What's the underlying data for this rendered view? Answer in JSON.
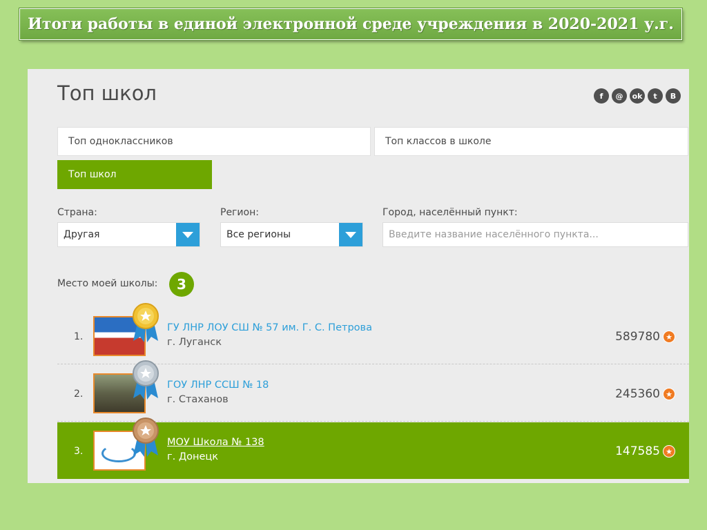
{
  "banner": {
    "title": "Итоги работы в единой электронной среде учреждения в 2020-2021 у.г."
  },
  "page": {
    "title": "Топ школ"
  },
  "social": [
    {
      "icon": "facebook-icon",
      "glyph": "f"
    },
    {
      "icon": "mail-icon",
      "glyph": "@"
    },
    {
      "icon": "odnoklassniki-icon",
      "glyph": "ok"
    },
    {
      "icon": "twitter-icon",
      "glyph": "t"
    },
    {
      "icon": "vk-icon",
      "glyph": "B"
    }
  ],
  "tabs": {
    "classmates": "Топ одноклассников",
    "classes": "Топ классов в школе",
    "schools": "Топ школ"
  },
  "filters": {
    "country_label": "Страна:",
    "country_value": "Другая",
    "region_label": "Регион:",
    "region_value": "Все регионы",
    "city_label": "Город, населённый пункт:",
    "city_placeholder": "Введите название населённого пункта..."
  },
  "my_school": {
    "label": "Место моей школы:",
    "rank": "3"
  },
  "colors": {
    "accent": "#6ea700",
    "link": "#2d9fd9",
    "star": "#f07b22",
    "background": "#b1dd85"
  },
  "rows": [
    {
      "pos": "1.",
      "name": "ГУ ЛНР ЛОУ СШ № 57 им. Г. С. Петрова",
      "city": "г. Луганск",
      "score": "589780",
      "medal": "gold"
    },
    {
      "pos": "2.",
      "name": "ГОУ ЛНР ССШ № 18",
      "city": "г. Стаханов",
      "score": "245360",
      "medal": "silver"
    },
    {
      "pos": "3.",
      "name": "МОУ Школа № 138",
      "city": "г. Донецк",
      "score": "147585",
      "medal": "bronze"
    }
  ]
}
